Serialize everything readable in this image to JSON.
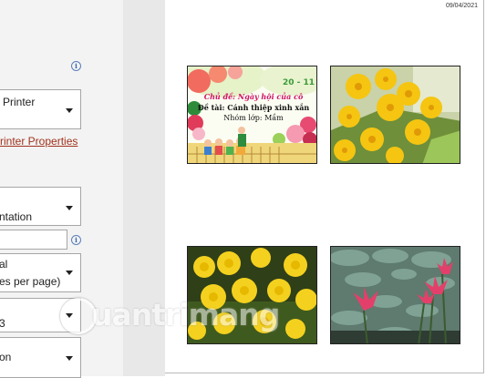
{
  "print_settings": {
    "printer": {
      "name": "Printer"
    },
    "printer_properties_link": "rinter Properties",
    "orientation": "ntation",
    "pages_field": {
      "value": ""
    },
    "pages_per_sheet": {
      "line1": "al",
      "line2": "es per page)"
    },
    "collation": {
      "value": "3"
    },
    "margins": {
      "value": "on"
    }
  },
  "preview": {
    "date": "09/04/2021",
    "card": {
      "number": "20 - 11",
      "title": "Chủ đề: Ngày hội của cô",
      "topic": "Đề tài: Cánh thiệp xinh xắn",
      "class": "Nhóm lớp: Mầm"
    },
    "images": [
      {
        "name": "yellow-apricot-blossom"
      },
      {
        "name": "yellow-chrysanthemum"
      },
      {
        "name": "pink-water-lily"
      }
    ]
  },
  "watermark": {
    "text": "uantrimang"
  },
  "colors": {
    "link": "#a0321c",
    "info_icon": "#2f63b4",
    "panel_bg": "#f3f3f3"
  }
}
